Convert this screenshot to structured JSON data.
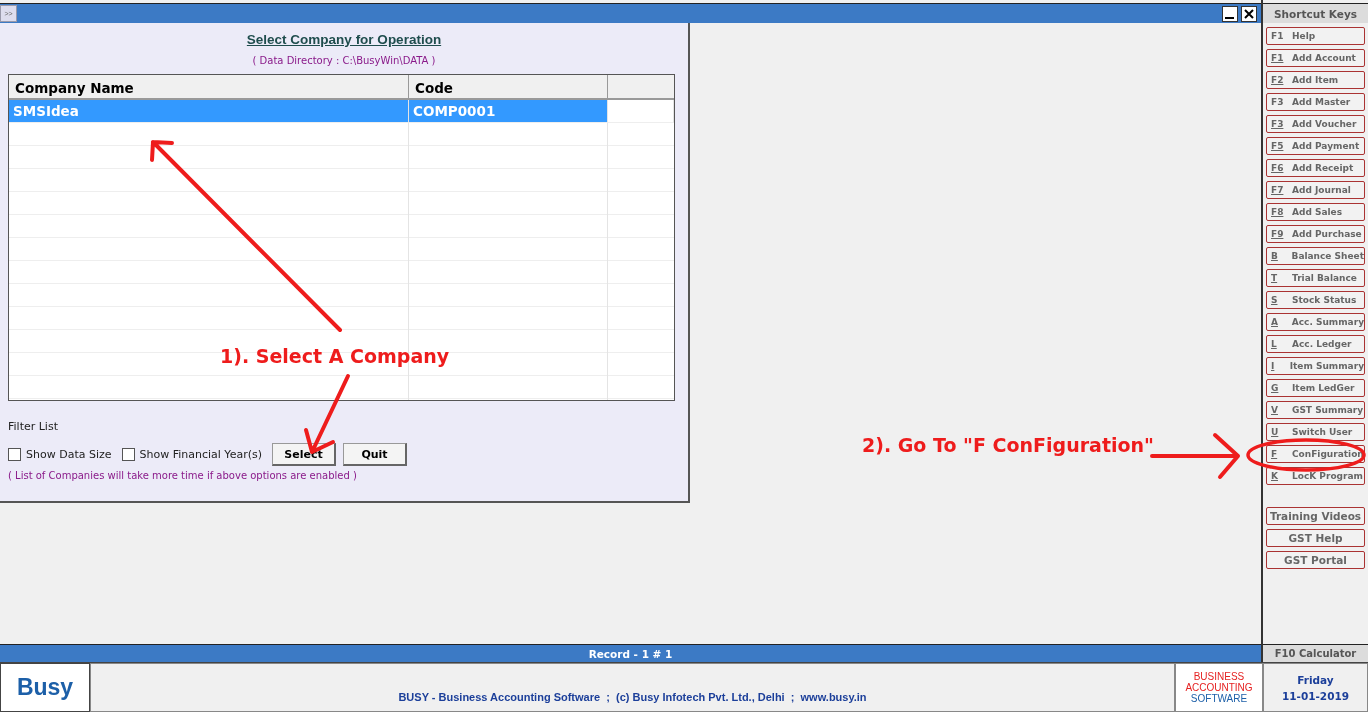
{
  "window": {
    "menu_button": ">>"
  },
  "dialog": {
    "title": "Select Company for Operation",
    "data_directory": "( Data Directory : C:\\BusyWin\\DATA )",
    "table": {
      "columns": [
        "Company Name",
        "Code"
      ],
      "rows": [
        {
          "name": "SMSIdea",
          "code": "COMP0001",
          "selected": true
        }
      ]
    },
    "filter_label": "Filter List",
    "options": [
      {
        "label": "Show Data Size",
        "checked": false
      },
      {
        "label": "Show Financial Year(s)",
        "checked": false
      }
    ],
    "buttons": [
      "Select",
      "Quit"
    ],
    "note": "( List of Companies will take more time if above options are enabled )"
  },
  "shortcuts": {
    "title": "Shortcut Keys",
    "items": [
      {
        "key": "F1",
        "label": "Help",
        "underlined": false
      },
      {
        "key": "F1",
        "label": "Add Account",
        "underlined": true
      },
      {
        "key": "F2",
        "label": "Add Item",
        "underlined": true
      },
      {
        "key": "F3",
        "label": "Add Master",
        "underlined": false
      },
      {
        "key": "F3",
        "label": "Add Voucher",
        "underlined": true
      },
      {
        "key": "F5",
        "label": "Add Payment",
        "underlined": true
      },
      {
        "key": "F6",
        "label": "Add Receipt",
        "underlined": true
      },
      {
        "key": "F7",
        "label": "Add Journal",
        "underlined": true
      },
      {
        "key": "F8",
        "label": "Add Sales",
        "underlined": true
      },
      {
        "key": "F9",
        "label": "Add Purchase",
        "underlined": true
      },
      {
        "key": "B",
        "label": "Balance Sheet",
        "underlined": true
      },
      {
        "key": "T",
        "label": "Trial Balance",
        "underlined": true
      },
      {
        "key": "S",
        "label": "Stock Status",
        "underlined": true
      },
      {
        "key": "A",
        "label": "Acc. Summary",
        "underlined": true
      },
      {
        "key": "L",
        "label": "Acc. Ledger",
        "underlined": true
      },
      {
        "key": "I",
        "label": "Item Summary",
        "underlined": true
      },
      {
        "key": "G",
        "label": "Item LedGer",
        "underlined": true
      },
      {
        "key": "V",
        "label": "GST Summary",
        "underlined": true
      },
      {
        "key": "U",
        "label": "Switch User",
        "underlined": true
      },
      {
        "key": "F",
        "label": "ConFiguration",
        "underlined": true
      },
      {
        "key": "K",
        "label": "LocK Program",
        "underlined": true
      }
    ],
    "links": [
      "Training Videos",
      "GST Help",
      "GST Portal"
    ],
    "calculator": "F10 Calculator"
  },
  "status_bar": {
    "record": "Record - 1 # 1"
  },
  "footer": {
    "logo": "Busy",
    "info": "BUSY - Business Accounting Software  ;  (c) Busy Infotech Pvt. Ltd., Delhi  ;  www.busy.in",
    "tagline": [
      "BUSINESS",
      "ACCOUNTING",
      "SOFTWARE"
    ],
    "day": "Friday",
    "date": "11-01-2019"
  },
  "annotations": [
    "1). Select A Company",
    "2). Go To \"F ConFiguration\""
  ]
}
